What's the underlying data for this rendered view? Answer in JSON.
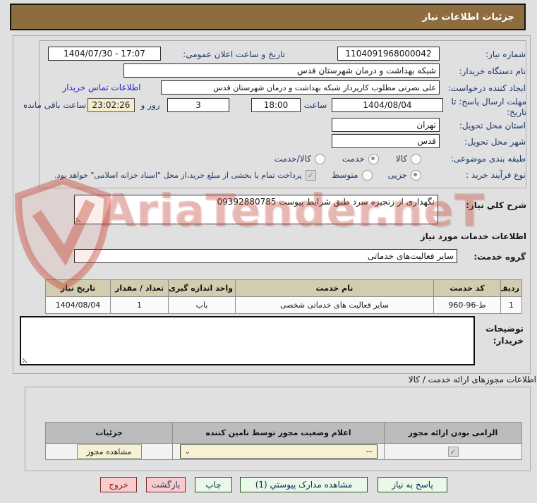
{
  "title_bar": {
    "title": "جزئیات اطلاعات نیاز"
  },
  "fields": {
    "need_number": {
      "label": "شماره نیاز:",
      "value": "1104091968000042"
    },
    "announce_datetime": {
      "label": "تاریخ و ساعت اعلان عمومی:",
      "value": "1404/07/30 - 17:07"
    },
    "buyer_org": {
      "label": "نام دستگاه خریدار:",
      "value": "شبکه بهداشت و درمان شهرستان قدس"
    },
    "request_creator": {
      "label": "ایجاد کننده درخواست:",
      "value": "علی نصرتی مطلوب کارپرداز شبکه بهداشت و درمان شهرستان قدس",
      "contact_link": "اطلاعات تماس خریدار"
    },
    "deadline": {
      "label": "مهلت ارسال پاسخ: تا تاریخ:",
      "date": "1404/08/04",
      "time_label": "ساعت",
      "time": "18:00",
      "days": "3",
      "days_label": "روز و",
      "countdown": "23:02:26",
      "countdown_label": "ساعت باقی مانده"
    },
    "province": {
      "label": "استان محل تحویل:",
      "value": "تهران"
    },
    "city": {
      "label": "شهر محل تحویل:",
      "value": "قدس"
    },
    "category": {
      "label": "طبقه بندی موضوعی:",
      "options": [
        {
          "label": "کالا",
          "checked": false
        },
        {
          "label": "خدمت",
          "checked": true
        },
        {
          "label": "کالا/خدمت",
          "checked": false
        }
      ]
    },
    "process_type": {
      "label": "نوع فرآیند خرید :",
      "options": [
        {
          "label": "جزیی",
          "checked": true
        },
        {
          "label": "متوسط",
          "checked": false
        }
      ],
      "treasury_note": "پرداخت تمام یا بخشی از مبلغ خرید،از محل \"اسناد خزانه اسلامی\" خواهد بود."
    }
  },
  "need_description": {
    "label": "شرح کلي نیاز:",
    "value": "نگهداری از زنجیره سرد طبق شرایط پیوست 09392880785"
  },
  "services_section": {
    "title": "اطلاعات خدمات مورد نیاز",
    "service_group_label": "گروه خدمت:",
    "service_group_value": "سایر فعالیت‌های خدماتی"
  },
  "services_table": {
    "headers": [
      "ردیف",
      "کد خدمت",
      "نام خدمت",
      "واحد اندازه گیری",
      "تعداد / مقدار",
      "تاریخ نیاز"
    ],
    "rows": [
      [
        "1",
        "ط-96-960",
        "سایر فعالیت های خدماتی شخصی",
        "باب",
        "1",
        "1404/08/04"
      ]
    ]
  },
  "buyer_notes": {
    "label": "توضیحات خریدار:",
    "value": ""
  },
  "permits_section": {
    "title": "اطلاعات مجوزهای ارائه خدمت / کالا"
  },
  "permits_table": {
    "headers": [
      "الزامی بودن ارائه مجوز",
      "اعلام وضعیت مجوز توسط تامین کننده",
      "جزئیات"
    ],
    "row": {
      "required_checked": true,
      "status_value": "--",
      "details_button": "مشاهده مجوز"
    }
  },
  "footer_buttons": {
    "respond": "پاسخ به نیاز",
    "view_attachments": "مشاهده مدارک پیوستي (1)",
    "print": "چاپ",
    "back": "بازگشت",
    "exit": "خروج"
  },
  "watermark": {
    "text": "AriaTender.neT"
  },
  "colors": {
    "title_bar": "#8d6c3d",
    "page_background": "#e0e0e0",
    "table1_header": "#d1cdae",
    "table2_header": "#bcbcbc",
    "countdown_background": "#f3edcb",
    "beige_control": "#f6f1d5",
    "green_button": "#e9f8e9",
    "pink_button": "#f9cbcb",
    "link": "#2323cc",
    "label_text": "#1e3a68",
    "watermark_red": "#c94a38"
  }
}
